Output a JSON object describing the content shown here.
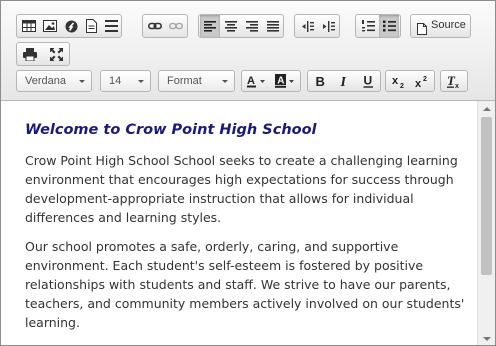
{
  "toolbar": {
    "source_label": "Source",
    "font_family": "Verdana",
    "font_size": "14",
    "format": "Format"
  },
  "document": {
    "heading": "Welcome to Crow Point High School",
    "paragraphs": [
      "Crow Point High School School seeks to create a challenging learning environment that encourages high expectations for success through development-appropriate instruction that allows for individual differences and learning styles.",
      "Our school promotes a safe, orderly, caring, and supportive environment. Each student's self-esteem is fostered by positive relationships with students and staff. We strive to have our parents, teachers, and community members actively involved on our students' learning."
    ]
  },
  "colors": {
    "heading": "#1a1a7a",
    "body_text": "#333333",
    "toolbar_bg": "#ececec"
  },
  "icons": [
    "table-icon",
    "image-icon",
    "flash-icon",
    "template-icon",
    "horizontal-rule-icon",
    "link-icon",
    "unlink-icon",
    "align-left-icon",
    "align-center-icon",
    "align-right-icon",
    "align-justify-icon",
    "outdent-icon",
    "indent-icon",
    "numbered-list-icon",
    "bulleted-list-icon",
    "source-icon",
    "print-icon",
    "maximize-icon",
    "text-color-icon",
    "background-color-icon",
    "bold-icon",
    "italic-icon",
    "underline-icon",
    "subscript-icon",
    "superscript-icon",
    "remove-format-icon"
  ]
}
